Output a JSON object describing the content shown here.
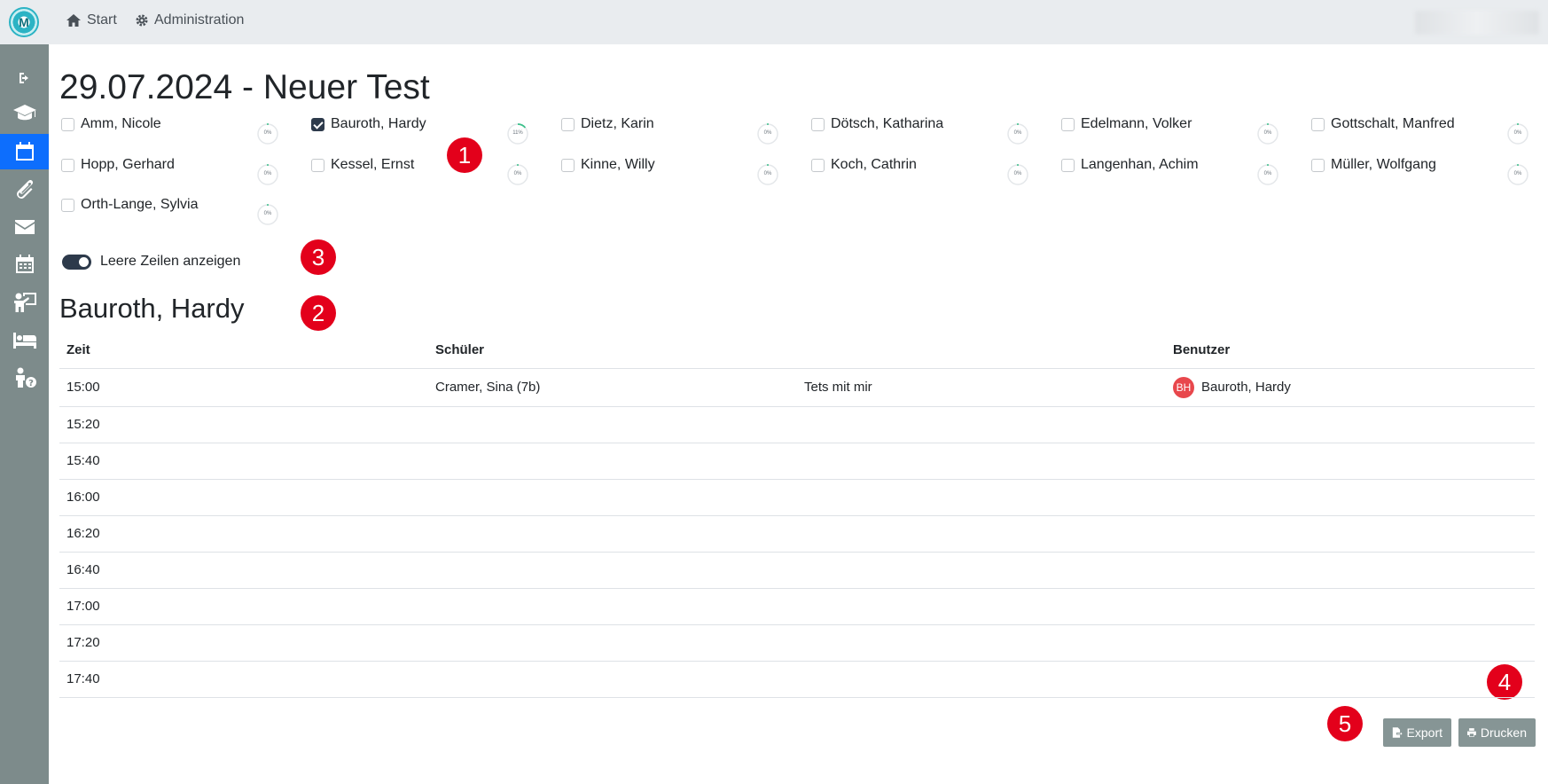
{
  "header": {
    "nav_start": "Start",
    "nav_admin": "Administration"
  },
  "sidebar": {
    "items": [
      "logout-icon",
      "graduation-cap-icon",
      "calendar-icon",
      "paperclip-icon",
      "envelope-icon",
      "calendar-days-icon",
      "teacher-board-icon",
      "bed-icon",
      "person-question-icon"
    ],
    "active": "calendar-icon"
  },
  "page": {
    "title": "29.07.2024 - Neuer Test"
  },
  "teachers": [
    {
      "name": "Amm, Nicole",
      "checked": false,
      "progress": "0%"
    },
    {
      "name": "Bauroth, Hardy",
      "checked": true,
      "progress": "11%"
    },
    {
      "name": "Dietz, Karin",
      "checked": false,
      "progress": "0%"
    },
    {
      "name": "Dötsch, Katharina",
      "checked": false,
      "progress": "0%"
    },
    {
      "name": "Edelmann, Volker",
      "checked": false,
      "progress": "0%"
    },
    {
      "name": "Gottschalt, Manfred",
      "checked": false,
      "progress": "0%"
    },
    {
      "name": "Hopp, Gerhard",
      "checked": false,
      "progress": "0%"
    },
    {
      "name": "Kessel, Ernst",
      "checked": false,
      "progress": "0%"
    },
    {
      "name": "Kinne, Willy",
      "checked": false,
      "progress": "0%"
    },
    {
      "name": "Koch, Cathrin",
      "checked": false,
      "progress": "0%"
    },
    {
      "name": "Langenhan, Achim",
      "checked": false,
      "progress": "0%"
    },
    {
      "name": "Müller, Wolfgang",
      "checked": false,
      "progress": "0%"
    },
    {
      "name": "Orth-Lange, Sylvia",
      "checked": false,
      "progress": "0%"
    }
  ],
  "toggle": {
    "label": "Leere Zeilen anzeigen",
    "on": true
  },
  "section": {
    "title": "Bauroth, Hardy"
  },
  "table": {
    "headers": [
      "Zeit",
      "Schüler",
      "",
      "Benutzer"
    ],
    "rows": [
      {
        "zeit": "15:00",
        "schueler": "Cramer, Sina (7b)",
        "notiz": "Tets mit mir",
        "initials": "BH",
        "benutzer": "Bauroth, Hardy"
      },
      {
        "zeit": "15:20",
        "schueler": "",
        "notiz": "",
        "initials": "",
        "benutzer": ""
      },
      {
        "zeit": "15:40",
        "schueler": "",
        "notiz": "",
        "initials": "",
        "benutzer": ""
      },
      {
        "zeit": "16:00",
        "schueler": "",
        "notiz": "",
        "initials": "",
        "benutzer": ""
      },
      {
        "zeit": "16:20",
        "schueler": "",
        "notiz": "",
        "initials": "",
        "benutzer": ""
      },
      {
        "zeit": "16:40",
        "schueler": "",
        "notiz": "",
        "initials": "",
        "benutzer": ""
      },
      {
        "zeit": "17:00",
        "schueler": "",
        "notiz": "",
        "initials": "",
        "benutzer": ""
      },
      {
        "zeit": "17:20",
        "schueler": "",
        "notiz": "",
        "initials": "",
        "benutzer": ""
      },
      {
        "zeit": "17:40",
        "schueler": "",
        "notiz": "",
        "initials": "",
        "benutzer": ""
      }
    ]
  },
  "buttons": {
    "export": "Export",
    "print": "Drucken"
  },
  "badges": [
    "1",
    "2",
    "3",
    "4",
    "5"
  ],
  "colors": {
    "badge": "#e3001b",
    "sidebar": "#7d8b8b",
    "active": "#0d6efd",
    "button": "#869595",
    "avatar": "#e8474c"
  }
}
